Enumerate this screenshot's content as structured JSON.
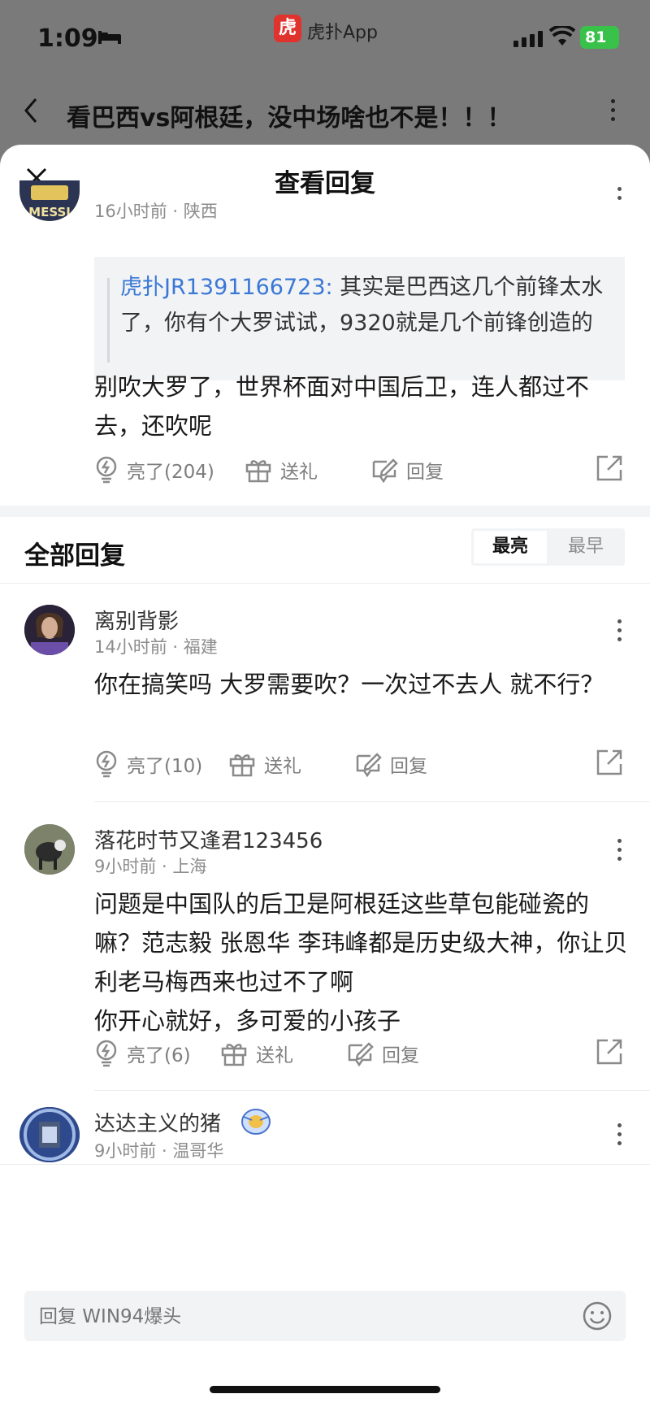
{
  "status_bar": {
    "time": "1:09",
    "app_badge": "虎",
    "app_name": "虎扑App",
    "battery": "81"
  },
  "background_header": {
    "title": "看巴西vs阿根廷，没中场啥也不是！！！"
  },
  "sheet": {
    "title": "查看回复"
  },
  "main_reply": {
    "meta": "16小时前 · 陕西",
    "quote_author": "虎扑JR1391166723:",
    "quote_text": " 其实是巴西这几个前锋太水了，你有个大罗试试，9320就是几个前锋创造的",
    "body": "别吹大罗了，世界杯面对中国后卫，连人都过不去，还吹呢",
    "light_label": "亮了(204)",
    "gift_label": "送礼",
    "reply_label": "回复"
  },
  "all_replies": {
    "title": "全部回复",
    "sort": {
      "active": "最亮",
      "inactive": "最早"
    },
    "items": [
      {
        "name": "离别背影",
        "meta": "14小时前 · 福建",
        "body": "你在搞笑吗 大罗需要吹？一次过不去人 就不行？",
        "light_label": "亮了(10)",
        "gift_label": "送礼",
        "reply_label": "回复"
      },
      {
        "name": "落花时节又逢君123456",
        "meta": "9小时前 · 上海",
        "body_lines": [
          "问题是中国队的后卫是阿根廷这些草包能碰瓷的嘛？范志毅 张恩华 李玮峰都是历史级大神，你让贝利老马梅西来也过不了啊",
          "你开心就好，多可爱的小孩子"
        ],
        "light_label": "亮了(6)",
        "gift_label": "送礼",
        "reply_label": "回复"
      },
      {
        "name": "达达主义的猪",
        "meta": "9小时前 · 温哥华"
      }
    ]
  },
  "input": {
    "placeholder": "回复 WIN94爆头"
  },
  "colors": {
    "link": "#3a78d6",
    "brand": "#e0332d",
    "battery": "#39c24a"
  }
}
